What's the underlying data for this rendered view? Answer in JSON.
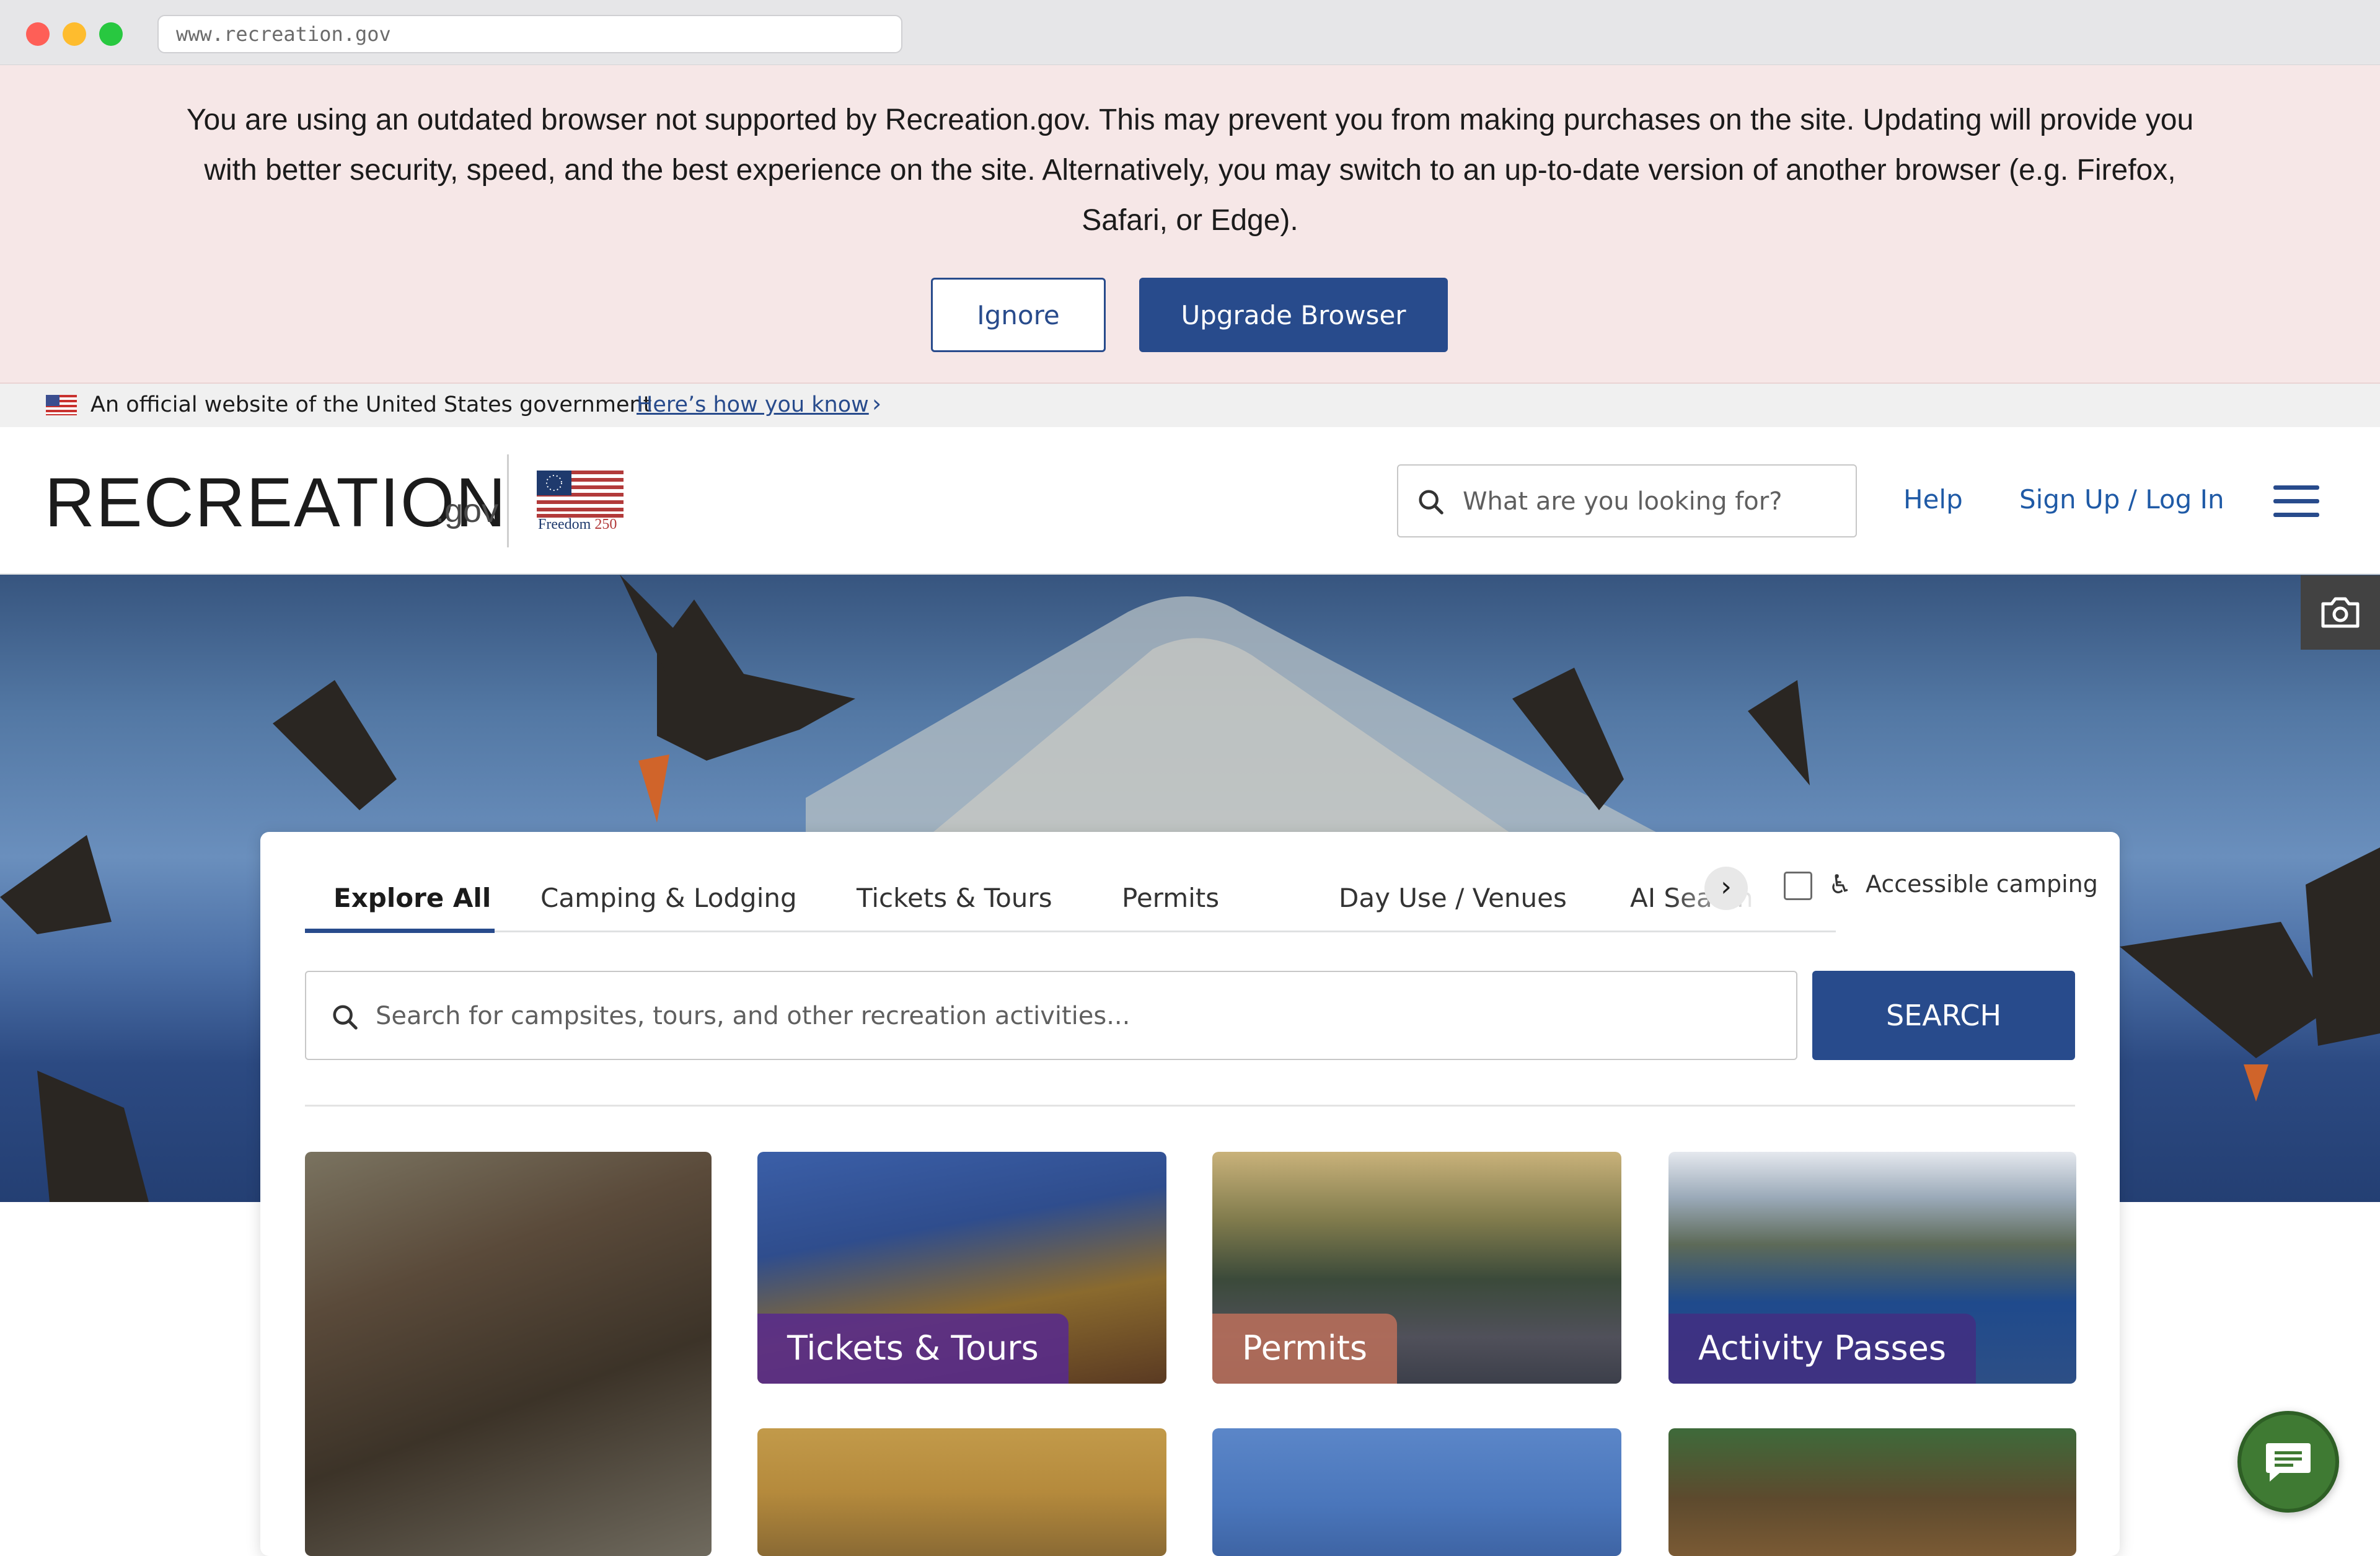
{
  "browser": {
    "url": "www.recreation.gov"
  },
  "banner": {
    "message": "You are using an outdated browser not supported by Recreation.gov. This may prevent you from making purchases on the site. Updating will provide you with better security, speed, and the best experience on the site. Alternatively, you may switch to an up-to-date version of another browser (e.g. Firefox, Safari, or Edge).",
    "ignore_label": "Ignore",
    "upgrade_label": "Upgrade Browser"
  },
  "gov_strip": {
    "text": "An official website of the United States government",
    "link": "Here’s how you know"
  },
  "header": {
    "logo": "RECREATION",
    "logo_suffix": ".gov",
    "freedom_text": "Freedom",
    "freedom_number": "250",
    "search_placeholder": "What are you looking for?",
    "help_label": "Help",
    "login_label": "Sign Up / Log In"
  },
  "search_card": {
    "tabs": [
      {
        "label": "Explore All",
        "active": true
      },
      {
        "label": "Camping & Lodging"
      },
      {
        "label": "Tickets & Tours"
      },
      {
        "label": "Permits"
      },
      {
        "label": "Day Use / Venues"
      },
      {
        "label": "AI Search"
      }
    ],
    "accessible_label": "Accessible camping",
    "search_placeholder": "Search for campsites, tours, and other recreation activities...",
    "search_button": "SEARCH",
    "tiles": [
      {
        "label": ""
      },
      {
        "label": "Tickets & Tours"
      },
      {
        "label": "Permits"
      },
      {
        "label": "Activity Passes"
      }
    ]
  },
  "icons": {
    "search": "search-icon",
    "camera": "camera-icon",
    "menu": "hamburger-menu-icon",
    "chat": "chat-icon",
    "accessibility": "accessibility-icon"
  },
  "colors": {
    "primary": "#284b8c",
    "banner_bg": "#f6e7e7",
    "link": "#1f5aa6",
    "chat": "#3f7a33"
  }
}
